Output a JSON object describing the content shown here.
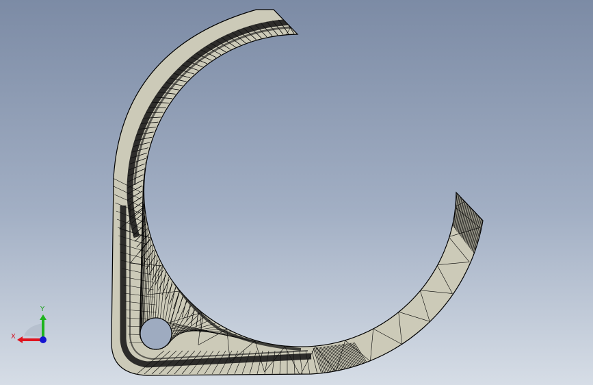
{
  "viewport": {
    "colors": {
      "background_top": "#7c8ba5",
      "background_bottom": "#d6dde6",
      "part_fill": "#cccab8",
      "mesh_edges": "#000000"
    }
  },
  "triad": {
    "x_label": "X",
    "y_label": "Y",
    "colors": {
      "x": "#e0141e",
      "y": "#1eb41e",
      "z": "#1414d2"
    }
  }
}
